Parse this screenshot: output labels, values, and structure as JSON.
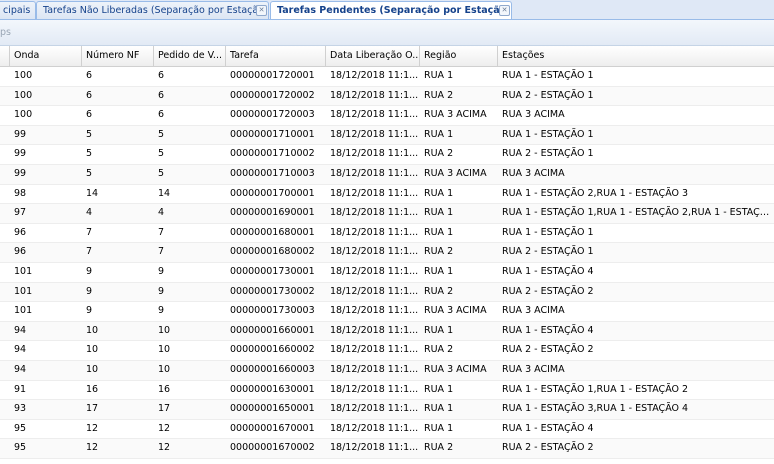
{
  "tabs": [
    {
      "label": "cipais"
    },
    {
      "label": "Tarefas Não Liberadas (Separação por Estação)"
    },
    {
      "label": "Tarefas Pendentes (Separação por Estação)"
    }
  ],
  "toolbar": {
    "partial_text": "ps"
  },
  "columns": [
    "Onda",
    "Número NF",
    "Pedido de V...",
    "Tarefa",
    "Data Liberação O...",
    "Região",
    "Estações"
  ],
  "rows": [
    [
      "100",
      "6",
      "6",
      "00000001720001",
      "18/12/2018 11:1...",
      "RUA 1",
      "RUA 1 - ESTAÇÃO 1"
    ],
    [
      "100",
      "6",
      "6",
      "00000001720002",
      "18/12/2018 11:1...",
      "RUA 2",
      "RUA 2 - ESTAÇÃO 1"
    ],
    [
      "100",
      "6",
      "6",
      "00000001720003",
      "18/12/2018 11:1...",
      "RUA 3 ACIMA",
      "RUA 3 ACIMA"
    ],
    [
      "99",
      "5",
      "5",
      "00000001710001",
      "18/12/2018 11:1...",
      "RUA 1",
      "RUA 1 - ESTAÇÃO 1"
    ],
    [
      "99",
      "5",
      "5",
      "00000001710002",
      "18/12/2018 11:1...",
      "RUA 2",
      "RUA 2 - ESTAÇÃO 1"
    ],
    [
      "99",
      "5",
      "5",
      "00000001710003",
      "18/12/2018 11:1...",
      "RUA 3 ACIMA",
      "RUA 3 ACIMA"
    ],
    [
      "98",
      "14",
      "14",
      "00000001700001",
      "18/12/2018 11:1...",
      "RUA 1",
      "RUA 1 - ESTAÇÃO 2,RUA 1 - ESTAÇÃO 3"
    ],
    [
      "97",
      "4",
      "4",
      "00000001690001",
      "18/12/2018 11:1...",
      "RUA 1",
      "RUA 1 - ESTAÇÃO 1,RUA 1 - ESTAÇÃO 2,RUA 1 - ESTAÇÃ..."
    ],
    [
      "96",
      "7",
      "7",
      "00000001680001",
      "18/12/2018 11:1...",
      "RUA 1",
      "RUA 1 - ESTAÇÃO 1"
    ],
    [
      "96",
      "7",
      "7",
      "00000001680002",
      "18/12/2018 11:1...",
      "RUA 2",
      "RUA 2 - ESTAÇÃO 1"
    ],
    [
      "101",
      "9",
      "9",
      "00000001730001",
      "18/12/2018 11:1...",
      "RUA 1",
      "RUA 1 - ESTAÇÃO 4"
    ],
    [
      "101",
      "9",
      "9",
      "00000001730002",
      "18/12/2018 11:1...",
      "RUA 2",
      "RUA 2 - ESTAÇÃO 2"
    ],
    [
      "101",
      "9",
      "9",
      "00000001730003",
      "18/12/2018 11:1...",
      "RUA 3 ACIMA",
      "RUA 3 ACIMA"
    ],
    [
      "94",
      "10",
      "10",
      "00000001660001",
      "18/12/2018 11:1...",
      "RUA 1",
      "RUA 1 - ESTAÇÃO 4"
    ],
    [
      "94",
      "10",
      "10",
      "00000001660002",
      "18/12/2018 11:1...",
      "RUA 2",
      "RUA 2 - ESTAÇÃO 2"
    ],
    [
      "94",
      "10",
      "10",
      "00000001660003",
      "18/12/2018 11:1...",
      "RUA 3 ACIMA",
      "RUA 3 ACIMA"
    ],
    [
      "91",
      "16",
      "16",
      "00000001630001",
      "18/12/2018 11:1...",
      "RUA 1",
      "RUA 1 - ESTAÇÃO 1,RUA 1 - ESTAÇÃO 2"
    ],
    [
      "93",
      "17",
      "17",
      "00000001650001",
      "18/12/2018 11:1...",
      "RUA 1",
      "RUA 1 - ESTAÇÃO 3,RUA 1 - ESTAÇÃO 4"
    ],
    [
      "95",
      "12",
      "12",
      "00000001670001",
      "18/12/2018 11:1...",
      "RUA 1",
      "RUA 1 - ESTAÇÃO 4"
    ],
    [
      "95",
      "12",
      "12",
      "00000001670002",
      "18/12/2018 11:1...",
      "RUA 2",
      "RUA 2 - ESTAÇÃO 2"
    ]
  ]
}
